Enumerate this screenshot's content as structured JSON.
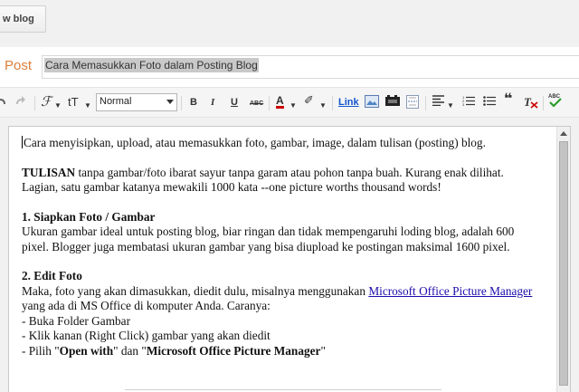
{
  "topbar": {
    "new_blog_label": "w blog"
  },
  "titlerow": {
    "post_label": "Post",
    "title_value": "Cara Memasukkan Foto dalam Posting Blog"
  },
  "toolbar": {
    "format_value": "Normal",
    "bold": "B",
    "italic": "I",
    "underline": "U",
    "strike": "ABC",
    "font_color": "A",
    "link": "Link",
    "spell": "ABC"
  },
  "editor": {
    "p1": "Cara menyisipkan, upload, atau memasukkan foto, gambar, image, dalam tulisan (posting) blog.",
    "p2_bold": "TULISAN",
    "p2_rest": " tanpa gambar/foto ibarat sayur tanpa garam atau pohon tanpa buah. Kurang enak dilihat. Lagian, satu gambar katanya mewakili 1000 kata --one picture worths thousand words!",
    "h1": "1. Siapkan Foto / Gambar",
    "p3": "Ukuran gambar ideal untuk posting blog, biar ringan dan tidak mempengaruhi loding blog, adalah 600 pixel. Blogger juga membatasi ukuran gambar yang bisa diupload ke postingan maksimal 1600 pixel.",
    "h2": "2. Edit Foto",
    "p4_start": "Maka, foto yang akan dimasukkan, diedit dulu, misalnya menggunakan ",
    "p4_link": "Microsoft Office Picture Manager",
    "p4_end": " yang ada di MS Office di komputer Anda. Caranya:",
    "li1": "- Buka Folder Gambar",
    "li2": "- Klik kanan (Right Click) gambar yang akan diedit",
    "li3_start": "- Pilih  \"",
    "li3_b1": "Open with",
    "li3_mid": "\" dan \"",
    "li3_b2": "Microsoft Office Picture Manager",
    "li3_end": "\""
  },
  "colors": {
    "post_label": "#dd7f3a",
    "link": "#1a0dab",
    "link_button": "#1155cc",
    "font_color_bar": "#cc0000"
  }
}
